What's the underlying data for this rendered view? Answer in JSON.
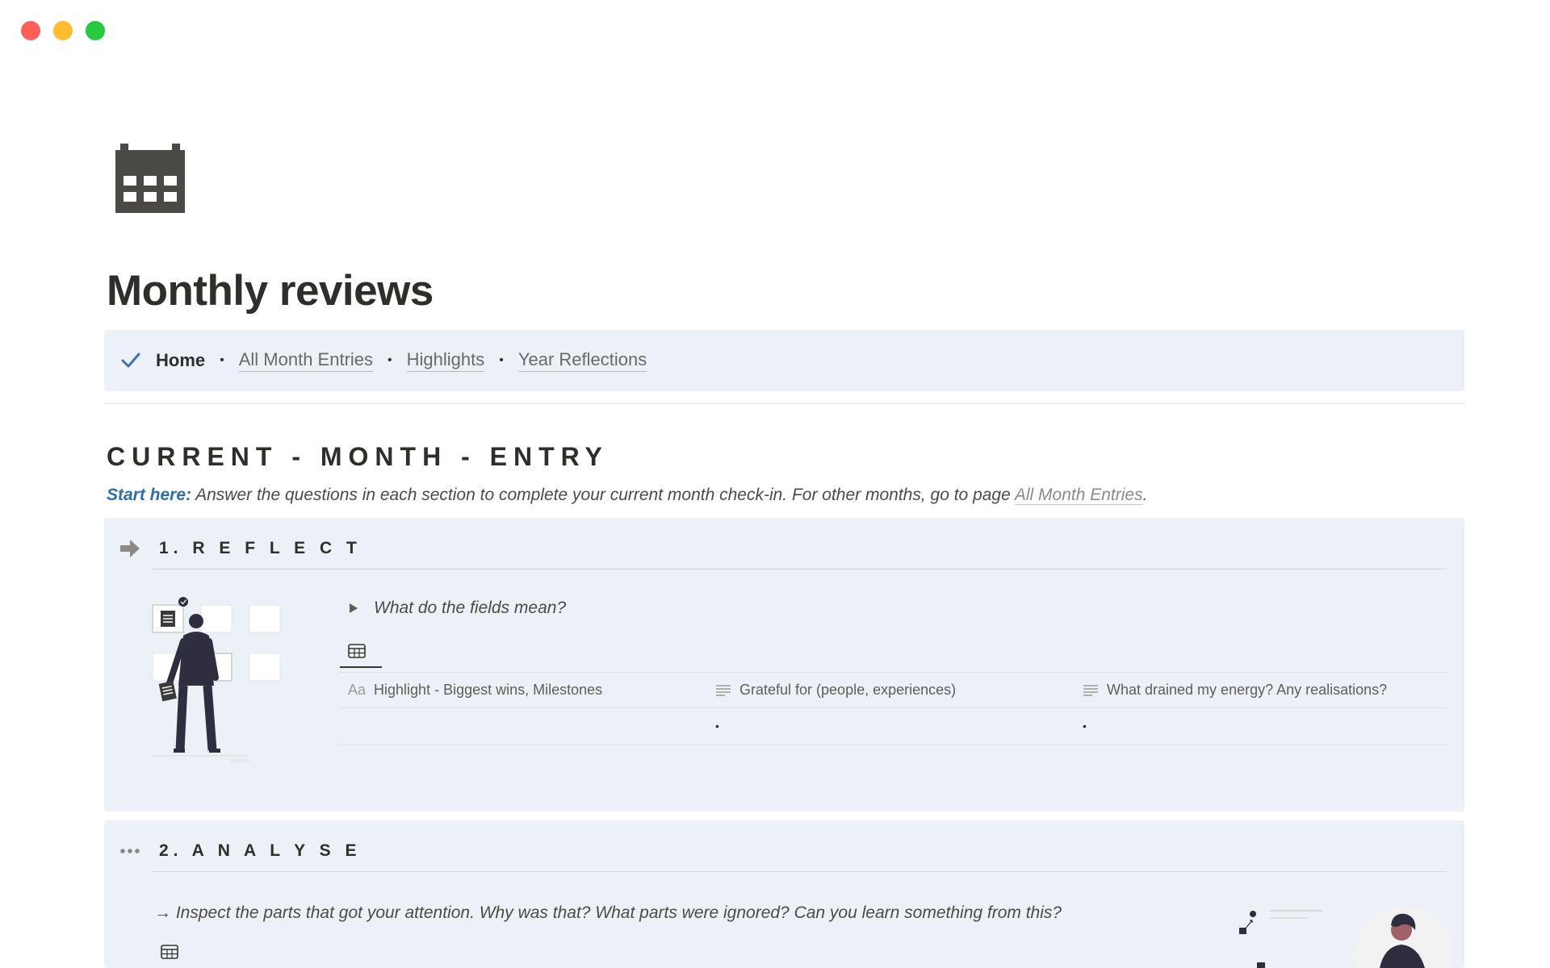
{
  "window": {
    "controls": [
      "close",
      "minimize",
      "maximize"
    ]
  },
  "page": {
    "icon": "calendar-icon",
    "title": "Monthly reviews"
  },
  "nav": {
    "home": "Home",
    "separator": "•",
    "links": [
      "All Month Entries",
      "Highlights",
      "Year Reflections"
    ]
  },
  "section": {
    "heading": "CURRENT - MONTH - ENTRY",
    "intro_start": "Start here:",
    "intro_text": " Answer the questions in each section to complete your current month check-in. For other months, go to page ",
    "intro_link": "All Month Entries",
    "intro_end": "."
  },
  "reflect": {
    "title": "1. R E F L E C T",
    "toggle": "What do the fields mean?",
    "columns": [
      {
        "icon": "Aa",
        "label": "Highlight - Biggest wins, Milestones"
      },
      {
        "icon": "text-lines-icon",
        "label": "Grateful for (people, experiences)"
      },
      {
        "icon": "text-lines-icon",
        "label": "What drained my energy? Any realisations?"
      }
    ],
    "row": [
      "",
      "•",
      "•"
    ]
  },
  "analyse": {
    "title": "2. A N A L Y S E",
    "text": "→ Inspect the parts that got your attention. Why was that? What parts were ignored?  Can you learn something from this?"
  },
  "colors": {
    "panel_bg": "#ebf1f7",
    "accent_blue": "#2f6fa6",
    "text": "#37352f"
  }
}
